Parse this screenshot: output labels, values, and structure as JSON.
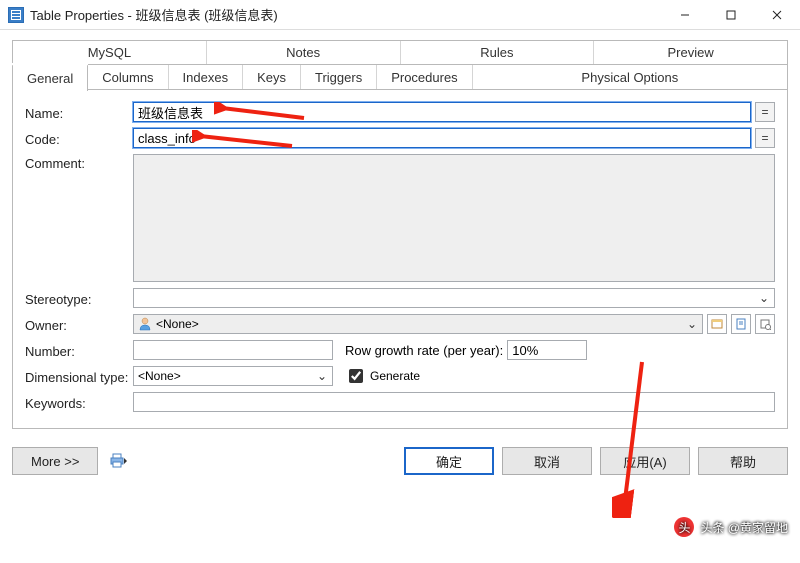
{
  "window": {
    "title": "Table Properties - 班级信息表 (班级信息表)"
  },
  "upper_tabs": [
    "MySQL",
    "Notes",
    "Rules",
    "Preview"
  ],
  "lower_tabs": [
    "General",
    "Columns",
    "Indexes",
    "Keys",
    "Triggers",
    "Procedures",
    "Physical Options"
  ],
  "active_lower_tab": "General",
  "labels": {
    "name": "Name:",
    "code": "Code:",
    "comment": "Comment:",
    "stereotype": "Stereotype:",
    "owner": "Owner:",
    "number": "Number:",
    "row_growth": "Row growth rate (per year):",
    "dim_type": "Dimensional type:",
    "generate": "Generate",
    "keywords": "Keywords:"
  },
  "values": {
    "name": "班级信息表",
    "code": "class_info",
    "comment": "",
    "stereotype": "",
    "owner": "<None>",
    "number": "",
    "row_growth": "10%",
    "dim_type": "<None>",
    "generate_checked": true,
    "keywords": ""
  },
  "buttons": {
    "eq": "=",
    "more": "More >>",
    "ok": "确定",
    "cancel": "取消",
    "apply": "应用(A)",
    "help": "帮助"
  },
  "watermark": "头条 @黄家留地"
}
